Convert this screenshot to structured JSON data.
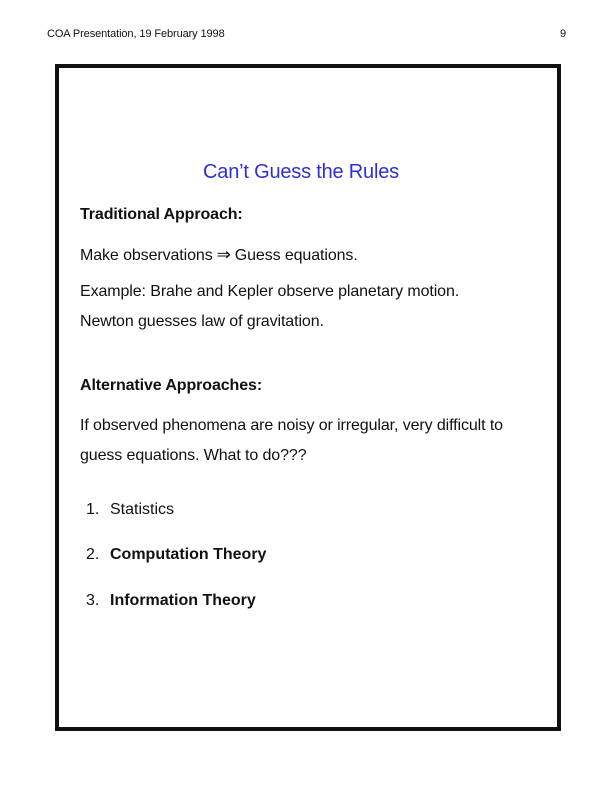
{
  "header": {
    "left": "COA Presentation, 19 February 1998",
    "page_number": "9"
  },
  "slide": {
    "title": "Can’t Guess the Rules",
    "traditional_heading": "Traditional Approach:",
    "observation_left": "Make observations",
    "arrow": "⇒",
    "observation_right": "Guess equations.",
    "example_line1": "Example: Brahe and Kepler observe planetary motion.",
    "example_line2": "Newton guesses law of gravitation.",
    "alternative_heading": "Alternative Approaches:",
    "question_line1": "If observed phenomena are noisy or irregular, very difficult to",
    "question_line2": "guess equations. What to do???",
    "list": [
      {
        "number": "1.",
        "label": "Statistics"
      },
      {
        "number": "2.",
        "label": "Computation Theory"
      },
      {
        "number": "3.",
        "label": "Information Theory"
      }
    ]
  }
}
